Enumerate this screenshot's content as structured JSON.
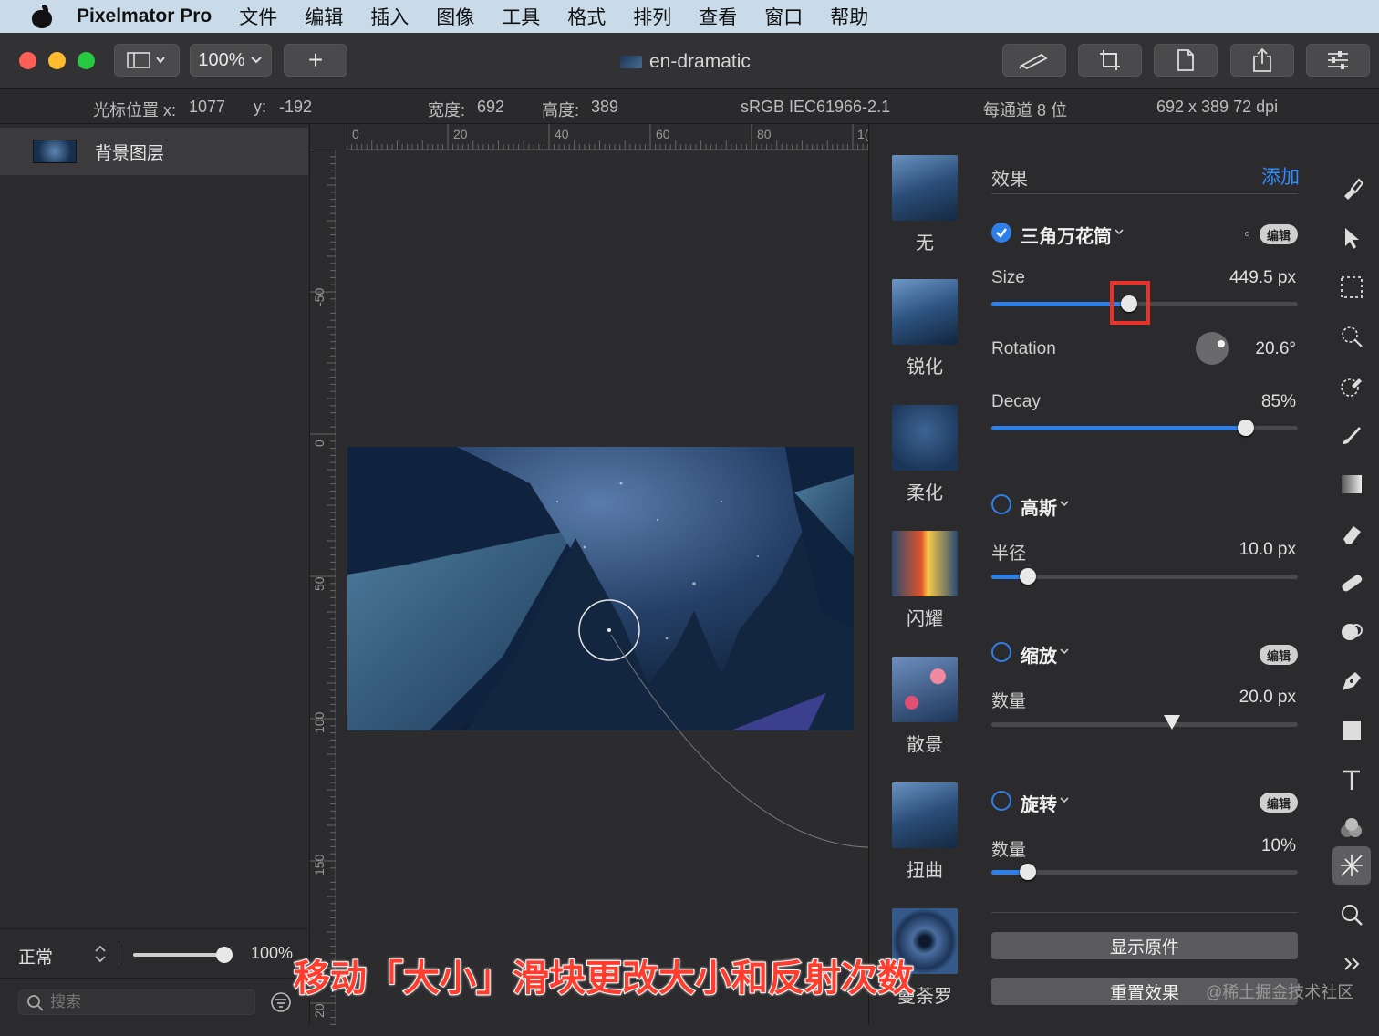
{
  "menubar": {
    "app_name": "Pixelmator Pro",
    "items": [
      "文件",
      "编辑",
      "插入",
      "图像",
      "工具",
      "格式",
      "排列",
      "查看",
      "窗口",
      "帮助"
    ]
  },
  "toolbar": {
    "zoom": "100%",
    "add_label": "+",
    "document_title": "en-dramatic"
  },
  "infobar": {
    "cursor_x_label": "光标位置 x:",
    "cursor_x": "1077",
    "cursor_y_label": "y:",
    "cursor_y": "-192",
    "width_label": "宽度:",
    "width": "692",
    "height_label": "高度:",
    "height": "389",
    "color_profile": "sRGB IEC61966-2.1",
    "bit_depth": "每通道 8 位",
    "dimensions": "692 x 389 72 dpi"
  },
  "layers": {
    "items": [
      {
        "name": "背景图层"
      }
    ],
    "blend_mode": "正常",
    "opacity": "100%",
    "opacity_value": 1.0,
    "search_placeholder": "搜索"
  },
  "rulers": {
    "top_ticks": [
      "0",
      "20",
      "40",
      "60",
      "80",
      "1("
    ],
    "left_ticks": [
      "-50",
      "0",
      "50",
      "100",
      "150",
      "20"
    ]
  },
  "presets": [
    {
      "label": "无"
    },
    {
      "label": "锐化"
    },
    {
      "label": "柔化"
    },
    {
      "label": "闪耀"
    },
    {
      "label": "散景"
    },
    {
      "label": "扭曲"
    },
    {
      "label": "曼荼罗"
    }
  ],
  "effects_panel": {
    "header": "效果",
    "add_label": "添加",
    "edit_label": "编辑",
    "kaleidoscope": {
      "title": "三角万花筒",
      "enabled": true,
      "size_label": "Size",
      "size_value": "449.5 px",
      "size_fraction": 0.45,
      "rotation_label": "Rotation",
      "rotation_value": "20.6°",
      "decay_label": "Decay",
      "decay_value": "85%",
      "decay_fraction": 0.83
    },
    "gaussian": {
      "title": "高斯",
      "enabled": false,
      "radius_label": "半径",
      "radius_value": "10.0 px",
      "radius_fraction": 0.12
    },
    "zoom": {
      "title": "缩放",
      "enabled": false,
      "amount_label": "数量",
      "amount_value": "20.0 px",
      "amount_fraction": 0.59
    },
    "spin": {
      "title": "旋转",
      "enabled": false,
      "amount_label": "数量",
      "amount_value": "10%",
      "amount_fraction": 0.12
    },
    "show_original": "显示原件",
    "reset_effects": "重置效果"
  },
  "caption": "移动「大小」滑块更改大小和反射次数",
  "watermark": "@稀土掘金技术社区",
  "colors": {
    "accent": "#2f7fe8",
    "highlight": "#e8322a",
    "caption": "#ff3d2e"
  }
}
